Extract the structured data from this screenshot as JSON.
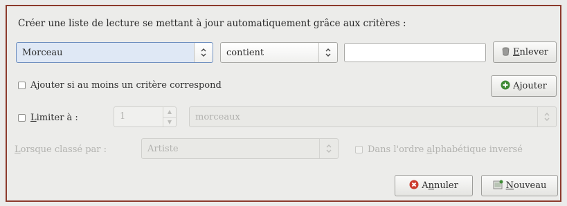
{
  "heading": "Créer une liste de lecture se mettant à jour automatiquement grâce aux critères :",
  "criteria": {
    "field": "Morceau",
    "operator": "contient",
    "value": "",
    "remove_prefix": "",
    "remove_mnemonic": "E",
    "remove_rest": "nlever"
  },
  "any_match": {
    "label": "Ajouter si au moins un critère correspond",
    "checked": false
  },
  "add_button": {
    "prefix": "A",
    "mnemonic": "j",
    "rest": "outer"
  },
  "limit": {
    "mnemonic": "L",
    "rest": "imiter à :",
    "checked": false,
    "count": "1",
    "unit": "morceaux"
  },
  "sort": {
    "mnemonic": "L",
    "rest": "orsque classé par :",
    "value": "Artiste",
    "reverse_prefix": "Dans l'ordre ",
    "reverse_mnemonic": "a",
    "reverse_rest": "lphabétique inversé"
  },
  "footer": {
    "cancel_prefix": "A",
    "cancel_mnemonic": "n",
    "cancel_rest": "nuler",
    "new_prefix": "",
    "new_mnemonic": "N",
    "new_rest": "ouveau"
  },
  "colors": {
    "dialog_border": "#8c3a2c",
    "cancel_icon": "#cc3b2e",
    "add_icon": "#3f8a35"
  }
}
